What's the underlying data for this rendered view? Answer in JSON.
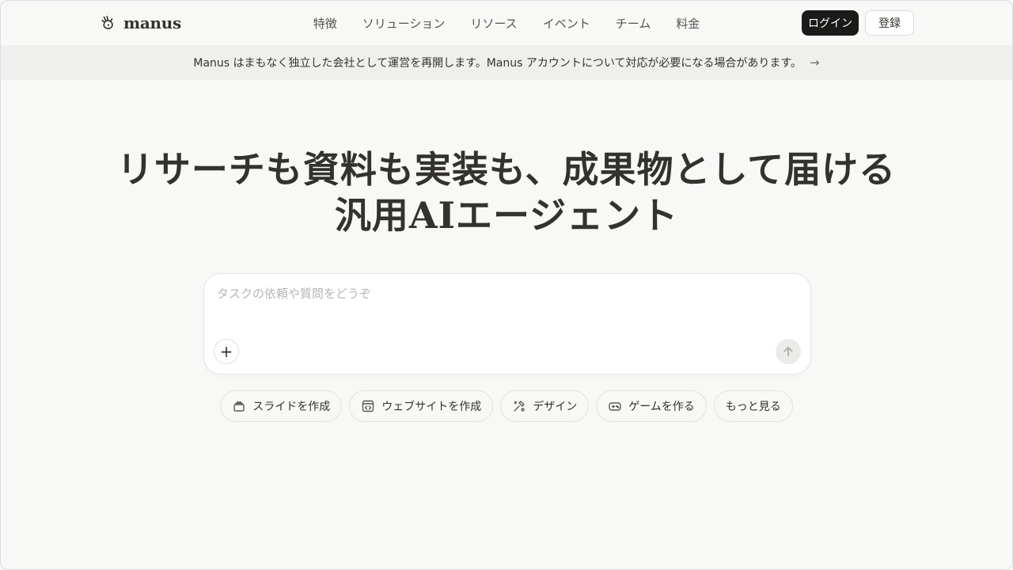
{
  "header": {
    "brand": "manus",
    "nav": [
      "特徴",
      "ソリューション",
      "リソース",
      "イベント",
      "チーム",
      "料金"
    ],
    "login_label": "ログイン",
    "register_label": "登録"
  },
  "banner": {
    "text": "Manus はまもなく独立した会社として運営を再開します。Manus アカウントについて対応が必要になる場合があります。",
    "arrow": "→"
  },
  "hero": {
    "line1": "リサーチも資料も実装も、成果物として届ける",
    "line2": "汎用AIエージェント"
  },
  "composer": {
    "placeholder": "タスクの依頼や質問をどうぞ",
    "value": "",
    "plus": "+"
  },
  "chips": [
    {
      "label": "スライドを作成",
      "icon": "slides-icon"
    },
    {
      "label": "ウェブサイトを作成",
      "icon": "code-window-icon"
    },
    {
      "label": "デザイン",
      "icon": "design-icon"
    },
    {
      "label": "ゲームを作る",
      "icon": "gamepad-icon"
    },
    {
      "label": "もっと見る",
      "icon": ""
    }
  ]
}
